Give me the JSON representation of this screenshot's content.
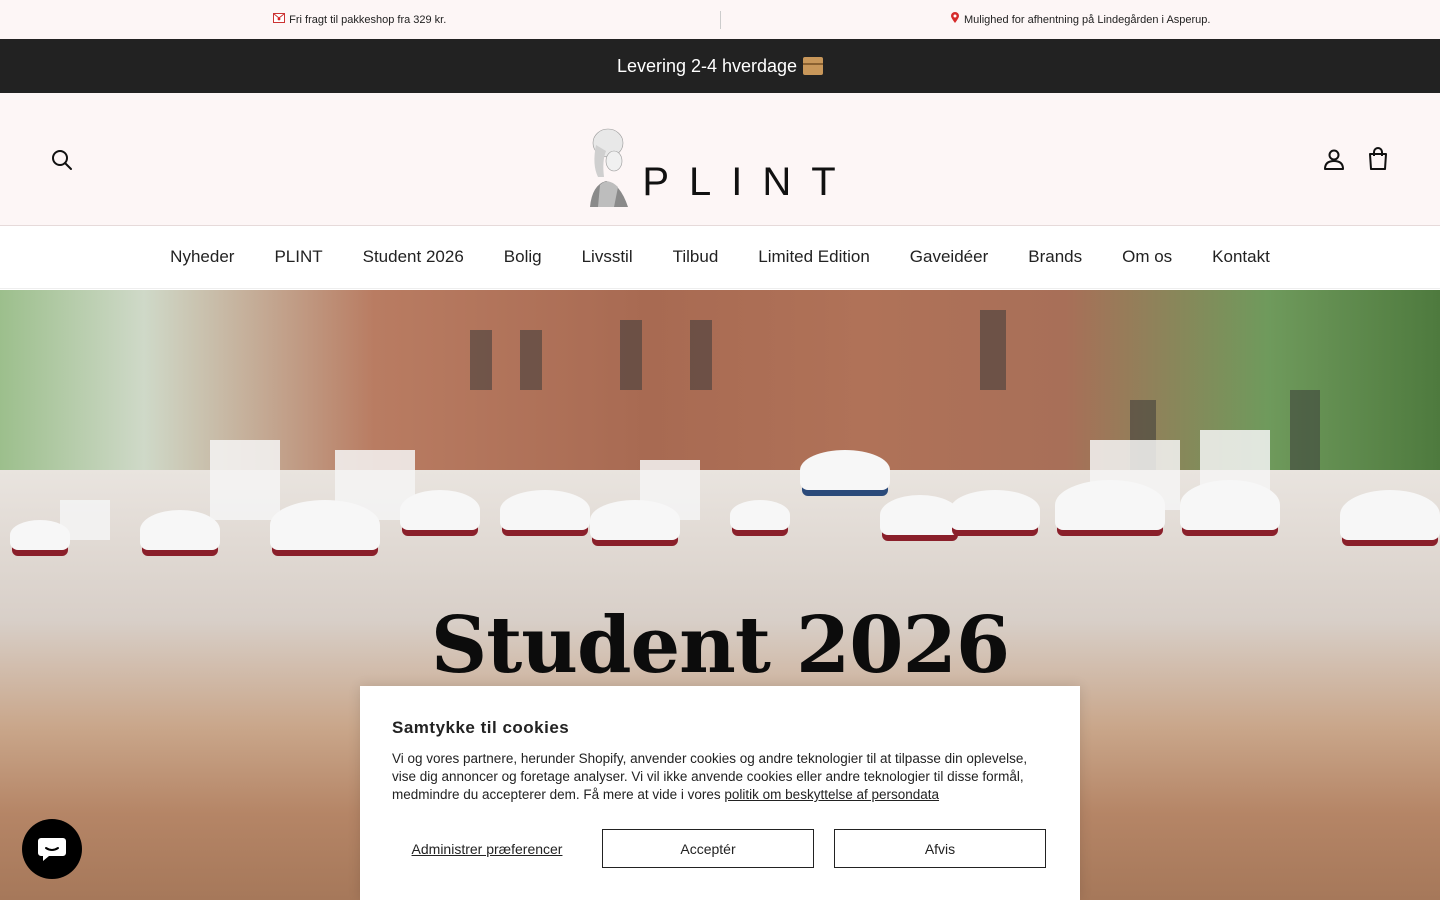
{
  "announcements": {
    "left": "Fri fragt til pakkeshop fra 329 kr.",
    "right": "Mulighed for afhentning på Lindegården i Asperup."
  },
  "delivery": {
    "text": "Levering 2-4 hverdage"
  },
  "header": {
    "logo_text": "PLINT"
  },
  "nav": {
    "items": [
      {
        "label": "Nyheder"
      },
      {
        "label": "PLINT"
      },
      {
        "label": "Student 2026"
      },
      {
        "label": "Bolig"
      },
      {
        "label": "Livsstil"
      },
      {
        "label": "Tilbud"
      },
      {
        "label": "Limited Edition"
      },
      {
        "label": "Gaveidéer"
      },
      {
        "label": "Brands"
      },
      {
        "label": "Om os"
      },
      {
        "label": "Kontakt"
      }
    ]
  },
  "hero": {
    "title": "Student 2026"
  },
  "cookie": {
    "title": "Samtykke til cookies",
    "body": "Vi og vores partnere, herunder Shopify, anvender cookies og andre teknologier til at tilpasse din oplevelse, vise dig annoncer og foretage analyser. Vi vil ikke anvende cookies eller andre teknologier til disse formål, medmindre du accepterer dem. Få mere at vide i vores",
    "link": "politik om beskyttelse af persondata",
    "manage": "Administrer præferencer",
    "accept": "Acceptér",
    "decline": "Afvis"
  },
  "icons": {
    "search": "search-icon",
    "account": "account-icon",
    "cart": "cart-icon",
    "chat": "chat-icon",
    "pin": "pin-icon",
    "mail": "mail-icon",
    "box": "box-icon"
  },
  "colors": {
    "announce_bg": "#fdf6f6",
    "delivery_bg": "#222222",
    "cookie_bg": "#ffffff"
  }
}
